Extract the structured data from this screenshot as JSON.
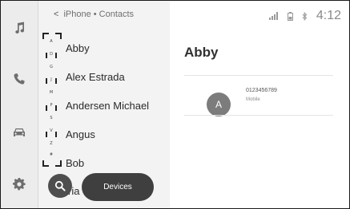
{
  "nav_rail": {
    "items": [
      {
        "icon": "music-note-icon"
      },
      {
        "icon": "phone-icon"
      },
      {
        "icon": "car-icon"
      },
      {
        "icon": "settings-gear-icon"
      }
    ]
  },
  "breadcrumb": {
    "back_icon": "chevron-left-icon",
    "text": "iPhone • Contacts"
  },
  "status_bar": {
    "icons": [
      "signal-icon",
      "battery-icon",
      "bluetooth-icon"
    ],
    "time": "4:12"
  },
  "index_bar": {
    "letters": [
      "A",
      "D",
      "G",
      "J",
      "M",
      "P",
      "S",
      "V",
      "Z",
      "#"
    ]
  },
  "contacts": [
    "Abby",
    "Alex Estrada",
    "Andersen Michael",
    "Angus",
    "Bob",
    "ria"
  ],
  "detail": {
    "name": "Abby",
    "avatar_initial": "A",
    "phone_number": "0123456789",
    "phone_type": "Mobile"
  },
  "actions": {
    "search_icon": "search-icon",
    "devices_label": "Devices"
  }
}
